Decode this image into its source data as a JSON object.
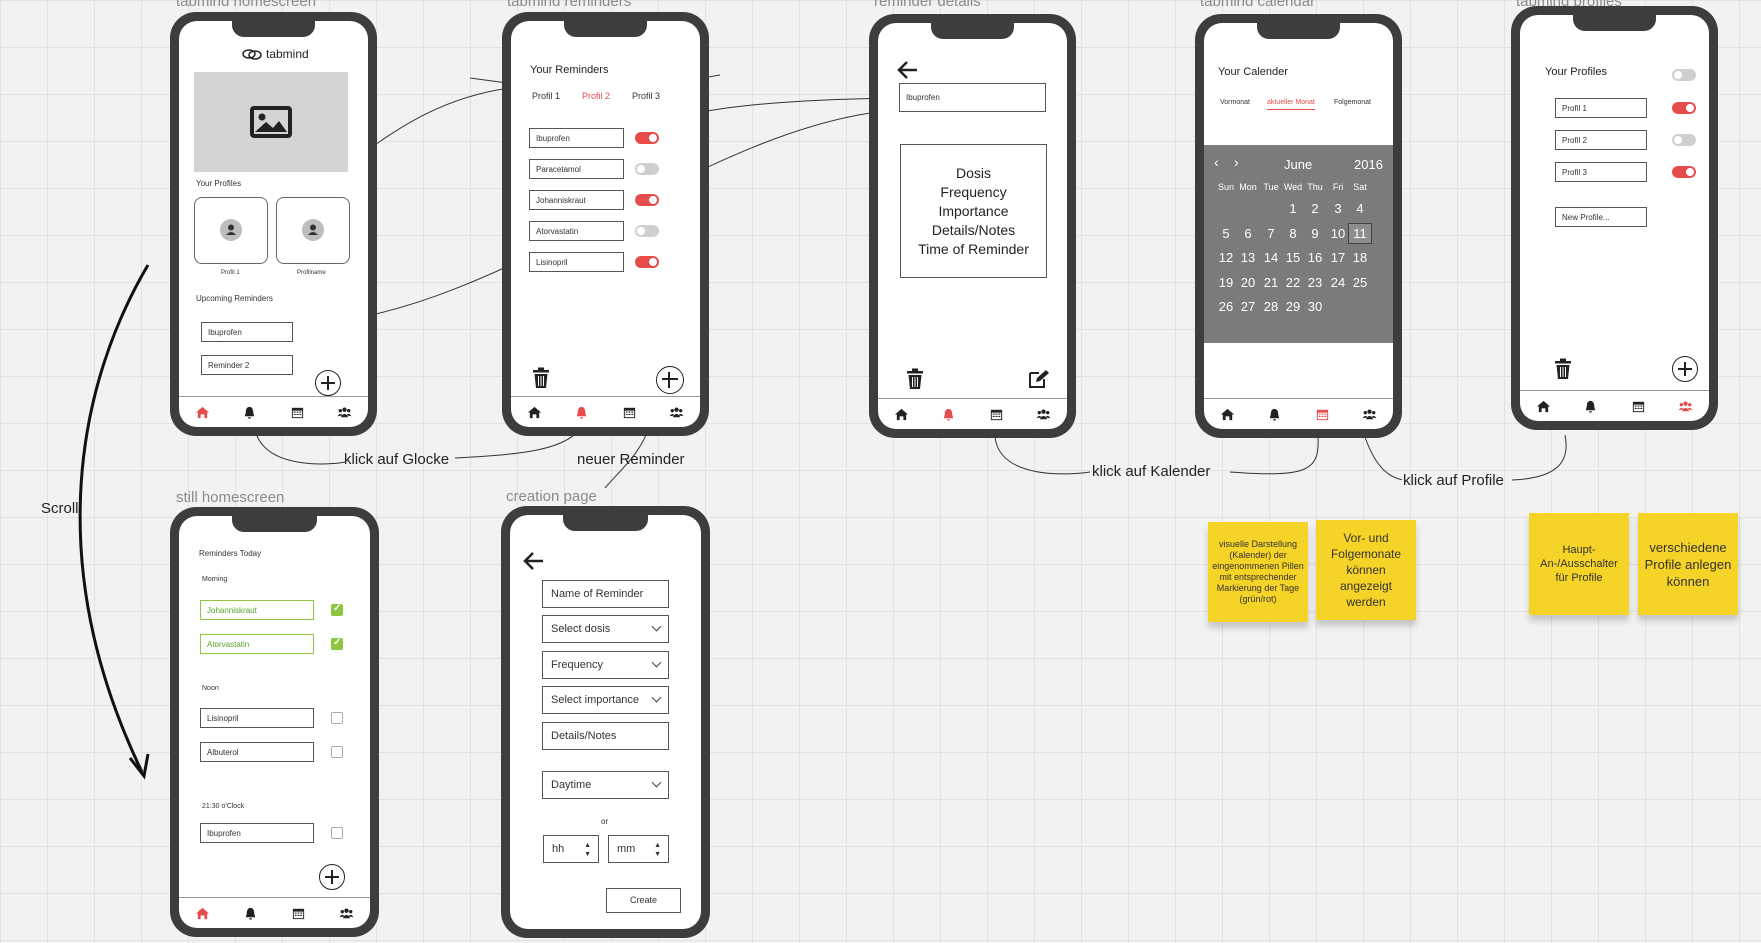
{
  "boards": {
    "home": "tabmind homescreen",
    "reminders": "tabmind reminders",
    "details": "reminder details",
    "calendar": "tabmind calendar",
    "profiles": "tabmind profiles",
    "still_home": "still homescreen",
    "creation": "creation page"
  },
  "home": {
    "app_name": "tabmind",
    "profiles_title": "Your Profiles",
    "profile1_label": "Profil 1",
    "profile2_label": "Profilname",
    "upcoming_title": "Upcoming Reminders",
    "upcoming": [
      "Ibuprofen",
      "Reminder 2"
    ]
  },
  "reminders": {
    "title": "Your Reminders",
    "tabs": [
      "Profil 1",
      "Profil 2",
      "Profil 3"
    ],
    "items": [
      {
        "name": "Ibuprofen",
        "on": true
      },
      {
        "name": "Paracetamol",
        "on": false
      },
      {
        "name": "Johanniskraut",
        "on": true
      },
      {
        "name": "Atorvastatin",
        "on": false
      },
      {
        "name": "Lisinopril",
        "on": true
      }
    ]
  },
  "details": {
    "field": "Ibuprofen",
    "box_lines": [
      "Dosis",
      "Frequency",
      "Importance",
      "Details/Notes",
      "Time of Reminder"
    ]
  },
  "calendar": {
    "title": "Your Calender",
    "tabs": [
      "Vormonat",
      "aktueller Monat",
      "Folgemonat"
    ],
    "month": "June",
    "year": "2016",
    "weekdays": [
      "Sun",
      "Mon",
      "Tue",
      "Wed",
      "Thu",
      "Fri",
      "Sat"
    ],
    "days": [
      "1",
      "2",
      "3",
      "4",
      "5",
      "6",
      "7",
      "8",
      "9",
      "10",
      "11",
      "12",
      "13",
      "14",
      "15",
      "16",
      "17",
      "18",
      "19",
      "20",
      "21",
      "22",
      "23",
      "24",
      "25",
      "26",
      "27",
      "28",
      "29",
      "30"
    ],
    "selected_day": "11"
  },
  "profiles": {
    "title": "Your Profiles",
    "items": [
      {
        "name": "Profil 1",
        "on": true
      },
      {
        "name": "Profil 2",
        "on": false
      },
      {
        "name": "Profil 3",
        "on": true
      }
    ],
    "new_profile": "New Profile..."
  },
  "still_home": {
    "title": "Reminders Today",
    "morning": "Morning",
    "morning_items": [
      "Johanniskraut",
      "Atorvastatin"
    ],
    "noon": "Noon",
    "noon_items": [
      "Lisinopril",
      "Albuterol"
    ],
    "evening": "21:30 o'Clock",
    "evening_items": [
      "Ibuprofen"
    ]
  },
  "creation": {
    "name_ph": "Name of Reminder",
    "dosis": "Select dosis",
    "frequency": "Frequency",
    "importance": "Select importance",
    "notes": "Details/Notes",
    "daytime": "Daytime",
    "or": "or",
    "hh": "hh",
    "mm": "mm",
    "create": "Create"
  },
  "annotations": {
    "bell": "klick auf Glocke",
    "new_reminder": "neuer Reminder",
    "calendar": "klick auf Kalender",
    "profiles": "klick auf Profile",
    "scroll": "Scroll"
  },
  "notes": {
    "n1": "visuelle Darstellung (Kalender) der eingenommenen Pillen mit entsprechender Markierung der Tage (grün/rot)",
    "n2": "Vor- und Folgemonate können angezeigt werden",
    "n3": "Haupt-An-/Ausschalter für Profile",
    "n4": "verschiedene Profile anlegen können"
  },
  "colors": {
    "accent": "#e64c4c",
    "frame": "#3d3d3d",
    "note": "#f5d327",
    "calendar_bg": "#7b7b7b",
    "check": "#8dc63f"
  }
}
